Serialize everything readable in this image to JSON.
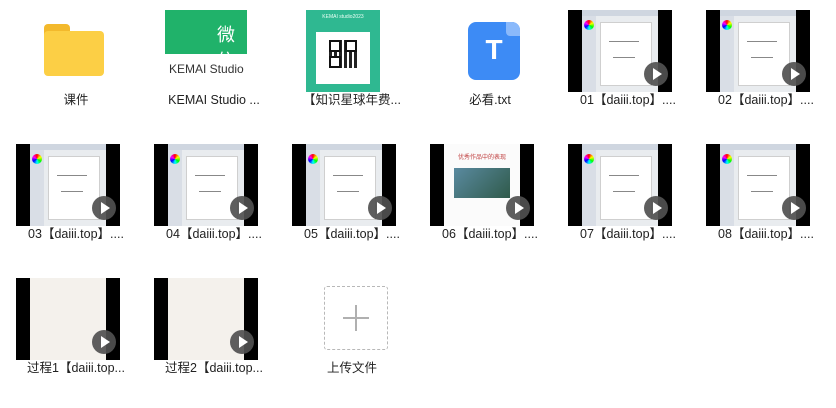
{
  "files": [
    {
      "label": "课件",
      "type": "folder",
      "icon": "folder-icon"
    },
    {
      "label": "KEMAI Studio ...",
      "type": "image-wechat",
      "icon": "wechat-image-thumbnail",
      "thumb_text": "微信",
      "thumb_search": "KEMAI Studio"
    },
    {
      "label": "【知识星球年费...",
      "type": "image-qr",
      "icon": "qr-code-thumbnail",
      "thumb_title": "KEMAI studio2023"
    },
    {
      "label": "必看.txt",
      "type": "txt",
      "icon": "txt-file-icon",
      "glyph": "T"
    },
    {
      "label": "01【daiii.top】....",
      "type": "video",
      "icon": "video-thumbnail"
    },
    {
      "label": "02【daiii.top】....",
      "type": "video",
      "icon": "video-thumbnail"
    },
    {
      "label": "03【daiii.top】....",
      "type": "video",
      "icon": "video-thumbnail"
    },
    {
      "label": "04【daiii.top】....",
      "type": "video",
      "icon": "video-thumbnail"
    },
    {
      "label": "05【daiii.top】....",
      "type": "video",
      "icon": "video-thumbnail"
    },
    {
      "label": "06【daiii.top】....",
      "type": "video",
      "icon": "video-thumbnail",
      "slide_title": "优秀作品中的表现"
    },
    {
      "label": "07【daiii.top】....",
      "type": "video",
      "icon": "video-thumbnail"
    },
    {
      "label": "08【daiii.top】....",
      "type": "video",
      "icon": "video-thumbnail"
    },
    {
      "label": "过程1【daiii.top...",
      "type": "video",
      "icon": "video-thumbnail"
    },
    {
      "label": "过程2【daiii.top...",
      "type": "video",
      "icon": "video-thumbnail"
    }
  ],
  "upload": {
    "label": "上传文件",
    "icon": "plus-icon"
  },
  "colors": {
    "folder": "#fccf45",
    "wechat": "#20b26a",
    "txt": "#3d8bf5"
  }
}
